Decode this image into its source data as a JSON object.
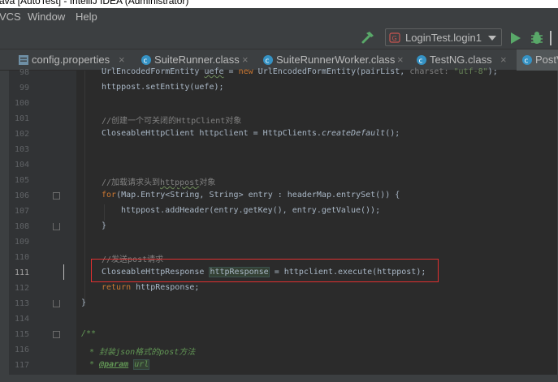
{
  "window": {
    "title": "ava [AutoTest] - IntelliJ IDEA (Administrator)"
  },
  "menubar": {
    "items": [
      "VCS",
      "Window",
      "Help"
    ]
  },
  "toolbar": {
    "run_config_label": "LoginTest.login1",
    "icons": [
      "hammer-icon",
      "run-config-icon",
      "chevron-down-icon",
      "run-icon",
      "debug-icon"
    ]
  },
  "tabs": [
    {
      "label": "config.properties",
      "icon": "properties-file-icon",
      "active": false
    },
    {
      "label": "SuiteRunner.class",
      "icon": "class-file-icon",
      "active": false
    },
    {
      "label": "SuiteRunnerWorker.class",
      "icon": "class-file-icon",
      "active": false
    },
    {
      "label": "TestNG.class",
      "icon": "class-file-icon",
      "active": false
    },
    {
      "label": "PostV",
      "icon": "class-file-icon",
      "active": true
    }
  ],
  "tab_close_glyph": "×",
  "editor": {
    "current_line": "111",
    "line_numbers": [
      "98",
      "99",
      "100",
      "101",
      "102",
      "103",
      "104",
      "105",
      "106",
      "107",
      "108",
      "109",
      "110",
      "111",
      "112",
      "113",
      "114",
      "115",
      "116",
      "117"
    ],
    "code": {
      "l98_a": "UrlEncodedFormEntity ",
      "l98_b": "uefe",
      "l98_c": " = ",
      "l98_d": "new",
      "l98_e": " UrlEncodedFormEntity(pairList, ",
      "l98_f": "charset:",
      "l98_g": " ",
      "l98_h": "\"utf-8\"",
      "l98_i": ");",
      "l99": "httppost.setEntity(uefe);",
      "l101": "//创建一个可关闭的HttpClient对象",
      "l102_a": "CloseableHttpClient httpclient = HttpClients.",
      "l102_b": "createDefault",
      "l102_c": "();",
      "l105_a": "//加载请求头到",
      "l105_b": "httppost",
      "l105_c": "对象",
      "l106_a": "for",
      "l106_b": "(Map.Entry<String, String> entry : headerMap.entrySet()) {",
      "l107": "httppost.addHeader(entry.getKey(), entry.getValue());",
      "l108": "}",
      "l110": "//发送post请求",
      "l111_a": "CloseableHttpResponse ",
      "l111_b": "httpResponse",
      "l111_c": " = httpclient.execute(httppost);",
      "l112_a": "return",
      "l112_b": " httpResponse;",
      "l113": "}",
      "l115": "/**",
      "l116_a": " * 封装",
      "l116_b": "json",
      "l116_c": "格式的",
      "l116_d": "post",
      "l116_e": "方法",
      "l117_a": " * ",
      "l117_b": "@param",
      "l117_c": " ",
      "l117_d": "url"
    }
  },
  "colors": {
    "background": "#2b2b2b",
    "keyword": "#cc7832",
    "comment": "#808080",
    "string": "#6a8759",
    "doc": "#629755",
    "highlight_box": "#e03030",
    "run_green": "#59a869"
  }
}
